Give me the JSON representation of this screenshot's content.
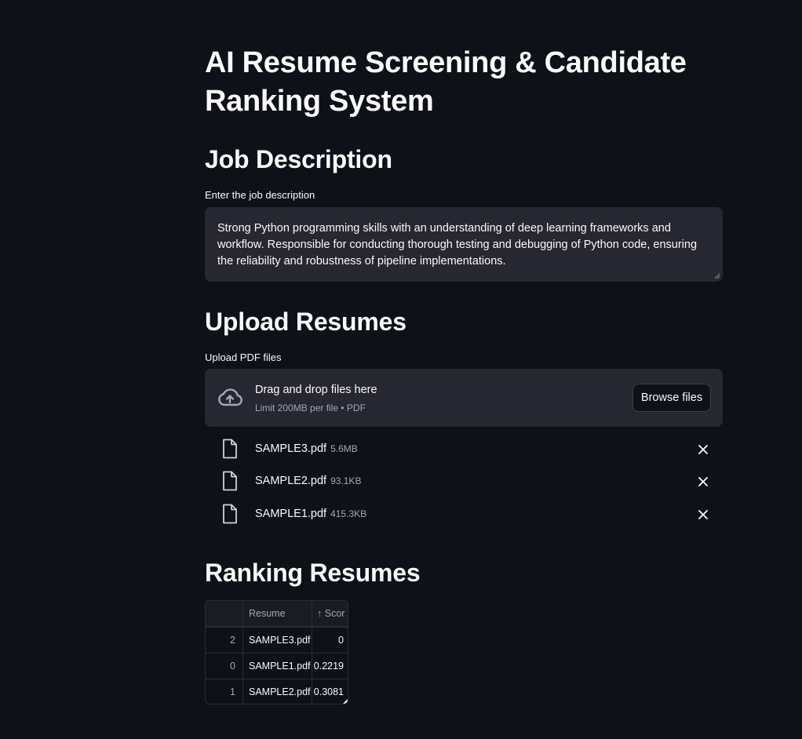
{
  "page": {
    "title": "AI Resume Screening & Candidate Ranking System"
  },
  "job": {
    "heading": "Job Description",
    "label": "Enter the job description",
    "text": "Strong Python programming skills with an understanding of deep learning frameworks and workflow. Responsible for conducting thorough testing and debugging of Python code, ensuring the reliability and robustness of pipeline implementations."
  },
  "upload": {
    "heading": "Upload Resumes",
    "label": "Upload PDF files",
    "drop_text": "Drag and drop files here",
    "limit_text": "Limit 200MB per file • PDF",
    "browse_label": "Browse files",
    "files": [
      {
        "name": "SAMPLE3.pdf",
        "size": "5.6MB"
      },
      {
        "name": "SAMPLE2.pdf",
        "size": "93.1KB"
      },
      {
        "name": "SAMPLE1.pdf",
        "size": "415.3KB"
      }
    ]
  },
  "ranking": {
    "heading": "Ranking Resumes",
    "columns": {
      "resume": "Resume",
      "score": "Scor",
      "sort_icon": "↑"
    },
    "rows": [
      {
        "index": "2",
        "resume": "SAMPLE3.pdf",
        "score": "0"
      },
      {
        "index": "0",
        "resume": "SAMPLE1.pdf",
        "score": "0.2219"
      },
      {
        "index": "1",
        "resume": "SAMPLE2.pdf",
        "score": "0.3081"
      }
    ]
  },
  "icons": {
    "upload": "cloud-upload-icon",
    "file": "file-icon",
    "remove": "close-icon"
  }
}
